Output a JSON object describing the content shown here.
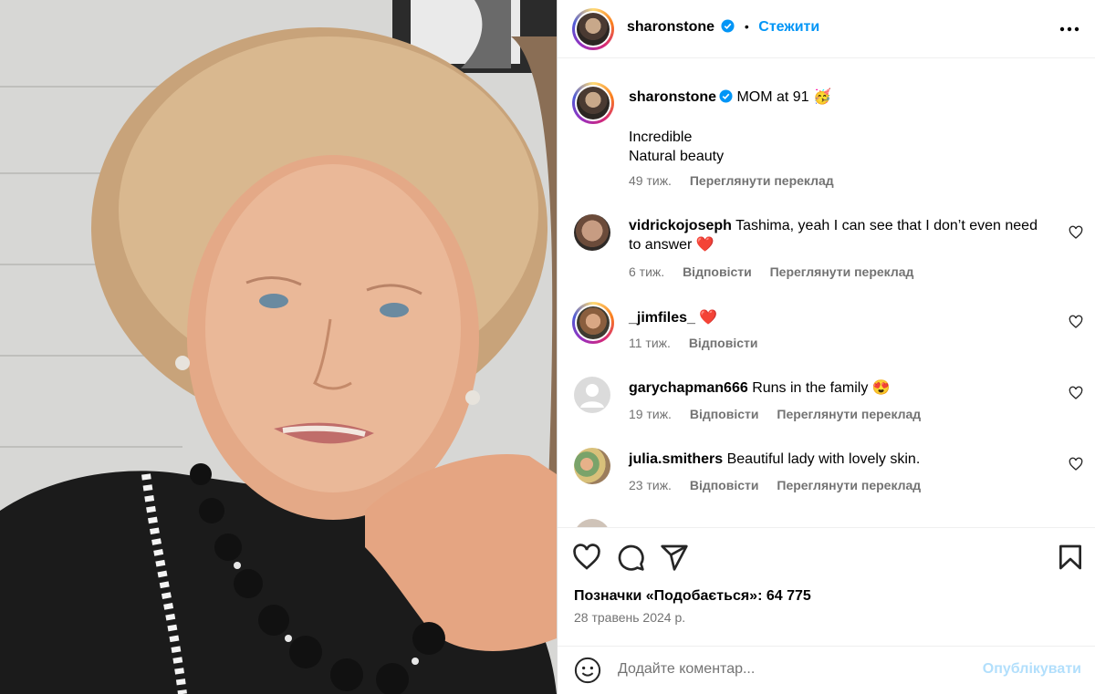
{
  "header": {
    "username": "sharonstone",
    "follow_label": "Стежити",
    "more_icon": "more-horizontal-icon"
  },
  "caption": {
    "username": "sharonstone",
    "text": "MOM at 91 🥳",
    "line2": "Incredible",
    "line3": "Natural beauty",
    "time": "49 тиж.",
    "translate": "Переглянути переклад"
  },
  "comments": [
    {
      "username": "vidrickojoseph",
      "text": "Tashima, yeah I can see that I don’t even need to answer ❤️",
      "time": "6 тиж.",
      "reply": "Відповісти",
      "translate": "Переглянути переклад"
    },
    {
      "username": "_jimfiles_",
      "text": "❤️",
      "time": "11 тиж.",
      "reply": "Відповісти"
    },
    {
      "username": "garychapman666",
      "text": "Runs in the family 😍",
      "time": "19 тиж.",
      "reply": "Відповісти",
      "translate": "Переглянути переклад"
    },
    {
      "username": "julia.smithers",
      "text": "Beautiful lady with lovely skin.",
      "time": "23 тиж.",
      "reply": "Відповісти",
      "translate": "Переглянути переклад"
    }
  ],
  "likes": "Позначки «Подобається»: 64 775",
  "date": "28 травень 2024 р.",
  "composer": {
    "placeholder": "Додайте коментар...",
    "post_label": "Опублікувати"
  },
  "colors": {
    "accent": "#0095f6",
    "muted": "#737373",
    "like_red": "#ff3040"
  }
}
